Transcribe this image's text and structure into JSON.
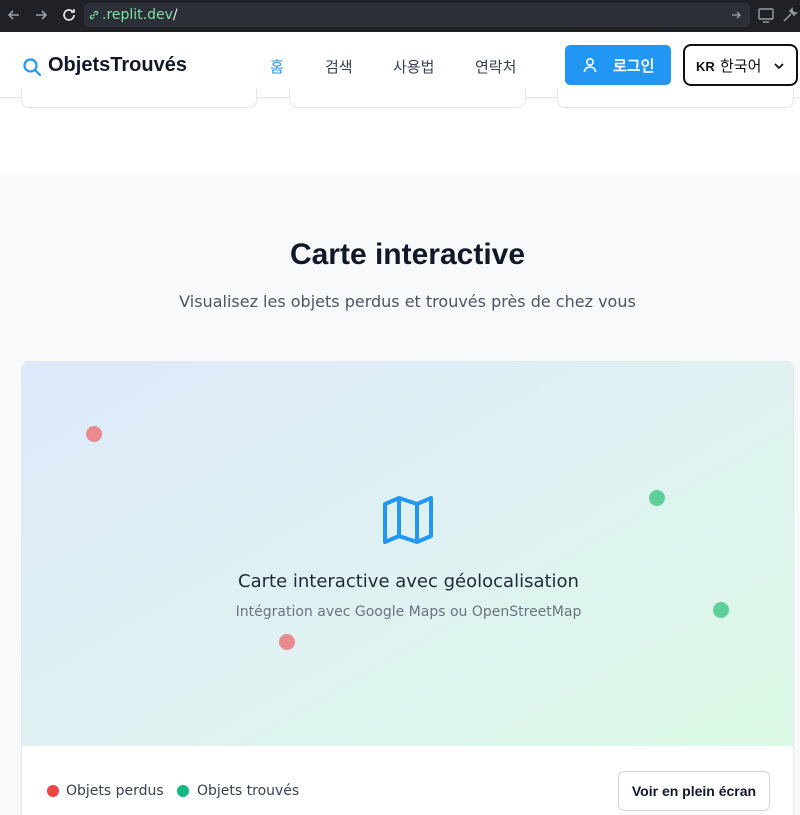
{
  "browser": {
    "url_host": ".replit.dev",
    "url_path": "/"
  },
  "header": {
    "logo_text": "ObjetsTrouvés",
    "nav": [
      {
        "label": "홈",
        "active": true
      },
      {
        "label": "검색",
        "active": false
      },
      {
        "label": "사용법",
        "active": false
      },
      {
        "label": "연락처",
        "active": false
      }
    ],
    "login_label": "로그인",
    "language": {
      "code": "KR",
      "name": "한국어"
    }
  },
  "section": {
    "title": "Carte interactive",
    "subtitle": "Visualisez les objets perdus et trouvés près de chez vous"
  },
  "map": {
    "title": "Carte interactive avec géolocalisation",
    "description": "Intégration avec Google Maps ou OpenStreetMap",
    "lost_color": "#ef4444",
    "found_color": "#10b981"
  },
  "legend": {
    "lost_label": "Objets perdus",
    "found_label": "Objets trouvés"
  },
  "fullscreen_label": "Voir en plein écran"
}
